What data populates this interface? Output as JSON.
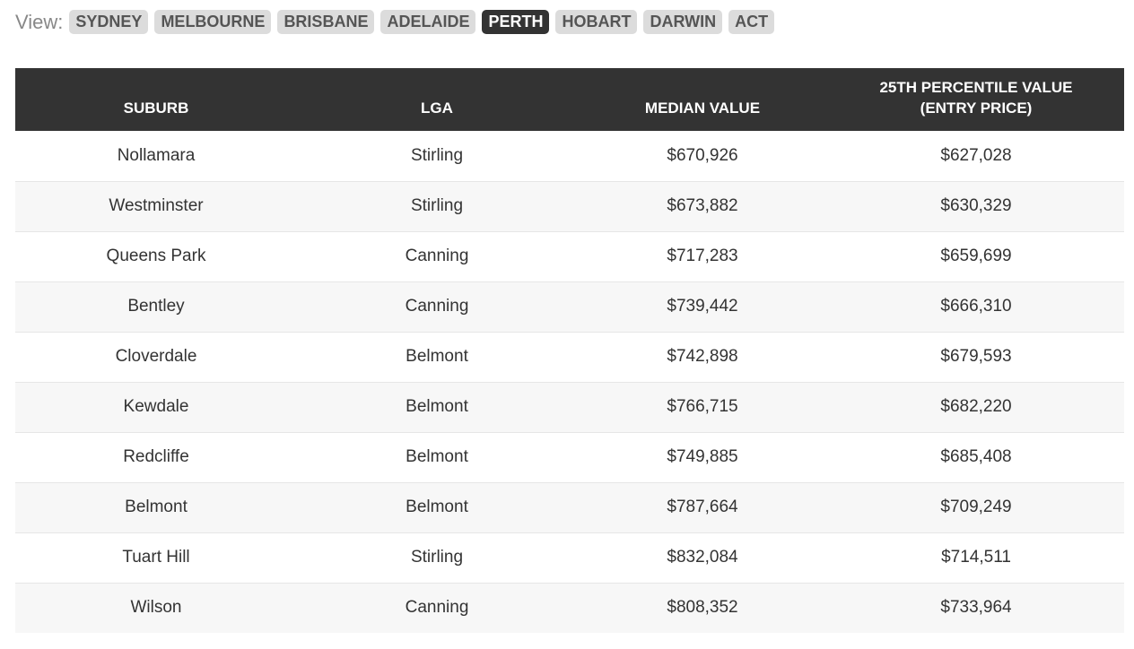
{
  "view": {
    "label": "View:",
    "cities": [
      {
        "label": "SYDNEY",
        "active": false
      },
      {
        "label": "MELBOURNE",
        "active": false
      },
      {
        "label": "BRISBANE",
        "active": false
      },
      {
        "label": "ADELAIDE",
        "active": false
      },
      {
        "label": "PERTH",
        "active": true
      },
      {
        "label": "HOBART",
        "active": false
      },
      {
        "label": "DARWIN",
        "active": false
      },
      {
        "label": "ACT",
        "active": false
      }
    ]
  },
  "table": {
    "headers": {
      "suburb": "SUBURB",
      "lga": "LGA",
      "median": "MEDIAN VALUE",
      "percentile_line1": "25TH PERCENTILE VALUE",
      "percentile_line2": "(ENTRY PRICE)"
    },
    "rows": [
      {
        "suburb": "Nollamara",
        "lga": "Stirling",
        "median": "$670,926",
        "entry": "$627,028"
      },
      {
        "suburb": "Westminster",
        "lga": "Stirling",
        "median": "$673,882",
        "entry": "$630,329"
      },
      {
        "suburb": "Queens Park",
        "lga": "Canning",
        "median": "$717,283",
        "entry": "$659,699"
      },
      {
        "suburb": "Bentley",
        "lga": "Canning",
        "median": "$739,442",
        "entry": "$666,310"
      },
      {
        "suburb": "Cloverdale",
        "lga": "Belmont",
        "median": "$742,898",
        "entry": "$679,593"
      },
      {
        "suburb": "Kewdale",
        "lga": "Belmont",
        "median": "$766,715",
        "entry": "$682,220"
      },
      {
        "suburb": "Redcliffe",
        "lga": "Belmont",
        "median": "$749,885",
        "entry": "$685,408"
      },
      {
        "suburb": "Belmont",
        "lga": "Belmont",
        "median": "$787,664",
        "entry": "$709,249"
      },
      {
        "suburb": "Tuart Hill",
        "lga": "Stirling",
        "median": "$832,084",
        "entry": "$714,511"
      },
      {
        "suburb": "Wilson",
        "lga": "Canning",
        "median": "$808,352",
        "entry": "$733,964"
      }
    ]
  }
}
